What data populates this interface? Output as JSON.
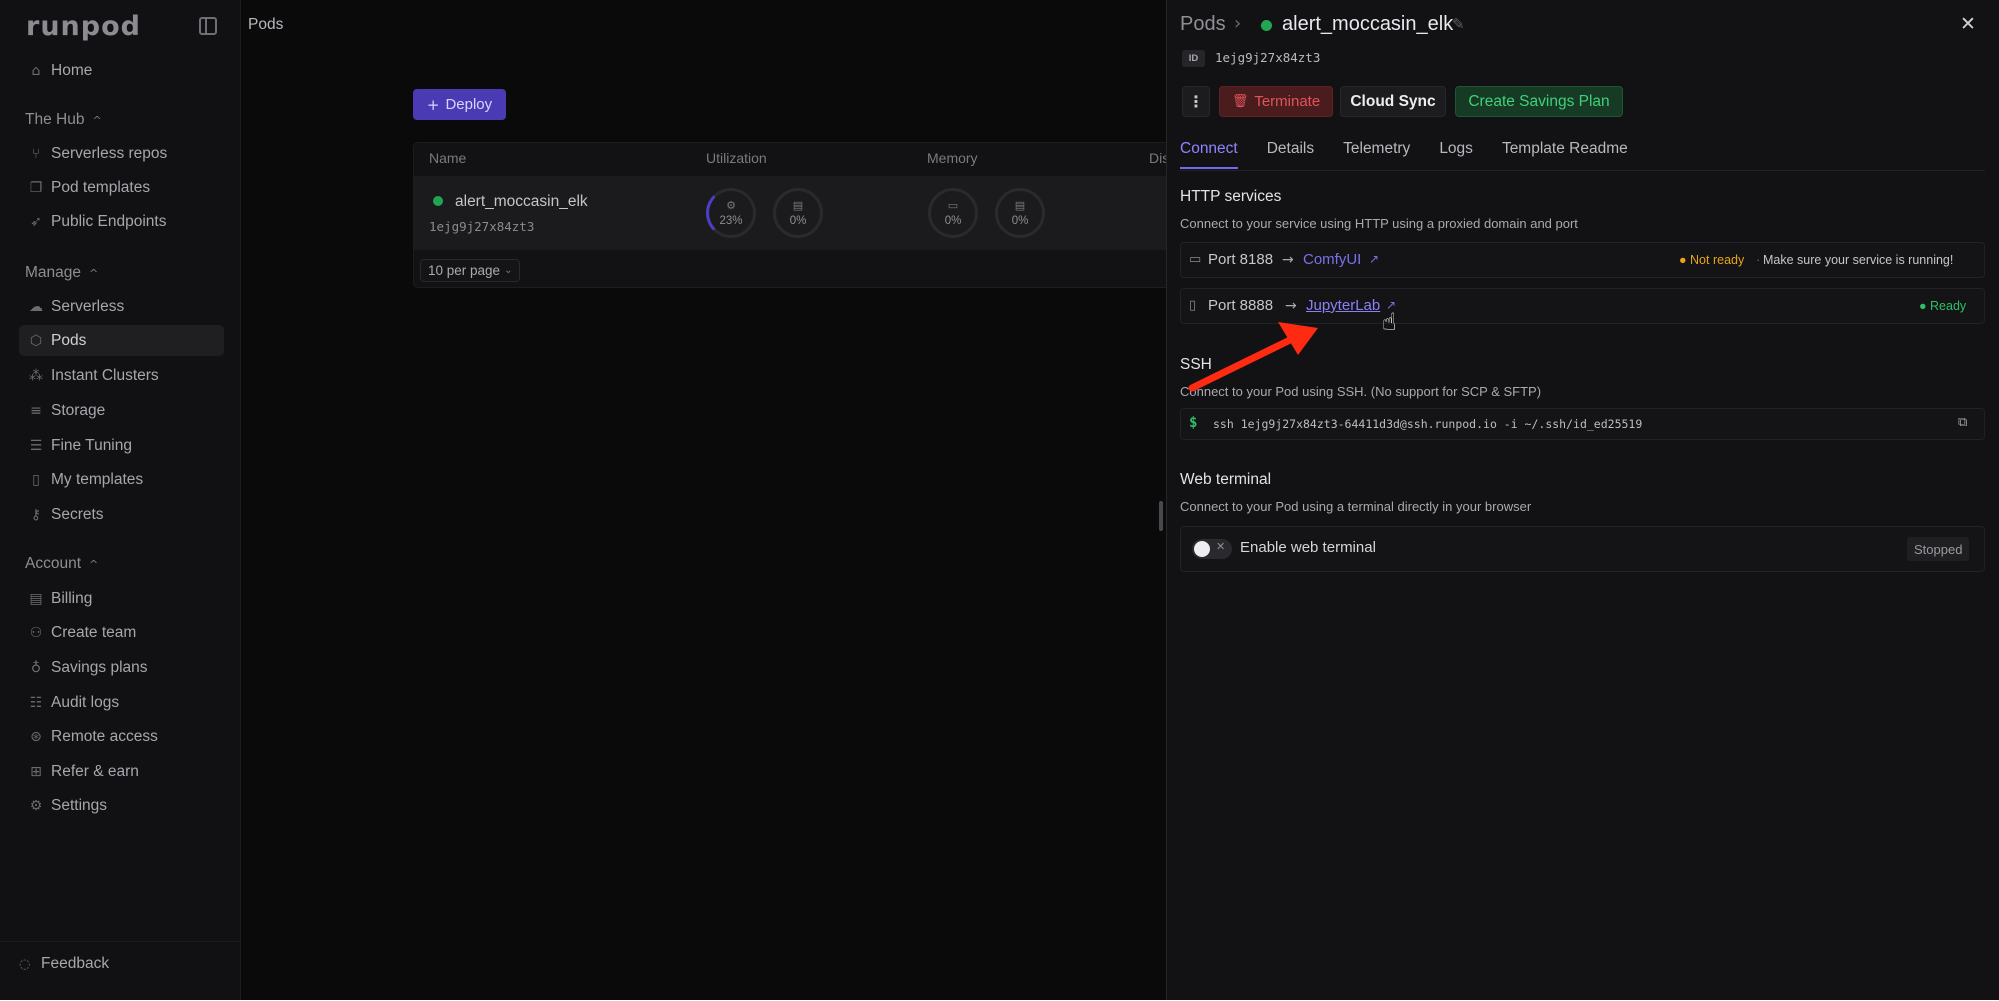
{
  "sidebar": {
    "logo": "runpod",
    "home": "Home",
    "hub": {
      "title": "The Hub",
      "items": [
        "Serverless repos",
        "Pod templates",
        "Public Endpoints"
      ]
    },
    "manage": {
      "title": "Manage",
      "items": [
        "Serverless",
        "Pods",
        "Instant Clusters",
        "Storage",
        "Fine Tuning",
        "My templates",
        "Secrets"
      ],
      "active": "Pods"
    },
    "account": {
      "title": "Account",
      "items": [
        "Billing",
        "Create team",
        "Savings plans",
        "Audit logs",
        "Remote access",
        "Refer & earn",
        "Settings"
      ]
    },
    "feedback": "Feedback"
  },
  "header": {
    "title": "Pods"
  },
  "main": {
    "deploy_label": "Deploy",
    "columns": [
      "Name",
      "Utilization",
      "Memory",
      "Dis"
    ],
    "pod": {
      "name": "alert_moccasin_elk",
      "id": "1ejg9j27x84zt3",
      "status_color": "#22a552"
    },
    "gauges": [
      {
        "icon": "cpu-icon",
        "value": "23%",
        "glyph": "⚙"
      },
      {
        "icon": "gpu-icon",
        "value": "0%",
        "glyph": "▤"
      },
      {
        "icon": "ram-icon",
        "value": "0%",
        "glyph": "▭"
      },
      {
        "icon": "vram-icon",
        "value": "0%",
        "glyph": "▤"
      }
    ],
    "per_page": "10 per page"
  },
  "panel": {
    "breadcrumb_root": "Pods",
    "pod_name": "alert_moccasin_elk",
    "id_badge": "ID",
    "id_value": "1ejg9j27x84zt3",
    "buttons": {
      "terminate": "Terminate",
      "cloud_sync": "Cloud Sync",
      "savings": "Create Savings Plan"
    },
    "tabs": [
      "Connect",
      "Details",
      "Telemetry",
      "Logs",
      "Template Readme"
    ],
    "active_tab": "Connect",
    "http": {
      "title": "HTTP services",
      "subtitle": "Connect to your service using HTTP using a proxied domain and port",
      "services": [
        {
          "port": "Port 8188",
          "name": "ComfyUI",
          "status": "Not ready",
          "hint": "Make sure your service is running!"
        },
        {
          "port": "Port 8888",
          "name": "JupyterLab",
          "status": "Ready"
        }
      ]
    },
    "ssh": {
      "title": "SSH",
      "subtitle": "Connect to your Pod using SSH. (No support for SCP & SFTP)",
      "prompt": "$",
      "command": "ssh 1ejg9j27x84zt3-64411d3d@ssh.runpod.io -i ~/.ssh/id_ed25519"
    },
    "web_terminal": {
      "title": "Web terminal",
      "subtitle": "Connect to your Pod using a terminal directly in your browser",
      "toggle_label": "Enable web terminal",
      "state": "Stopped",
      "enabled": false
    }
  },
  "colors": {
    "accent": "#7568f0",
    "ready": "#2fbf68",
    "warning": "#e8a317",
    "danger": "#e0545a",
    "annotation_arrow": "#ff2a12"
  }
}
